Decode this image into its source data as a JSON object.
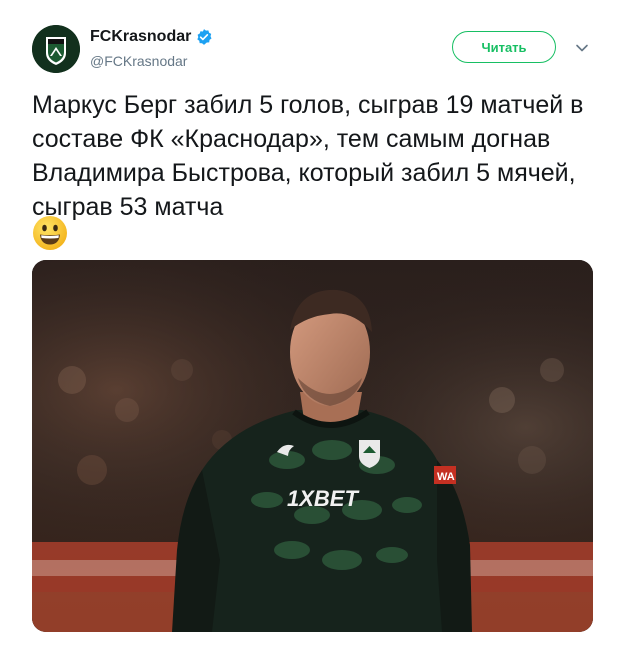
{
  "user": {
    "display_name": "FCKrasnodar",
    "handle": "@FCKrasnodar",
    "verified": true
  },
  "follow_button_label": "Читать",
  "tweet": {
    "text": "Маркус Берг забил 5 голов, сыграв 19 матчей в составе ФК «Краснодар», тем самым догнав Владимира Быстрова, который забил 5 мячей, сыграв 53 матча",
    "emoji": "smiling-face-emoji"
  },
  "media": {
    "jersey_sponsor": "1XBET",
    "sleeve_patch": "WA"
  },
  "icons": [
    "fc-krasnodar-crest-icon",
    "verified-badge-icon",
    "chevron-down-icon"
  ],
  "colors": {
    "follow_green": "#17bf63",
    "verified_blue": "#1da1f2",
    "handle_gray": "#657786",
    "text": "#14171a"
  }
}
